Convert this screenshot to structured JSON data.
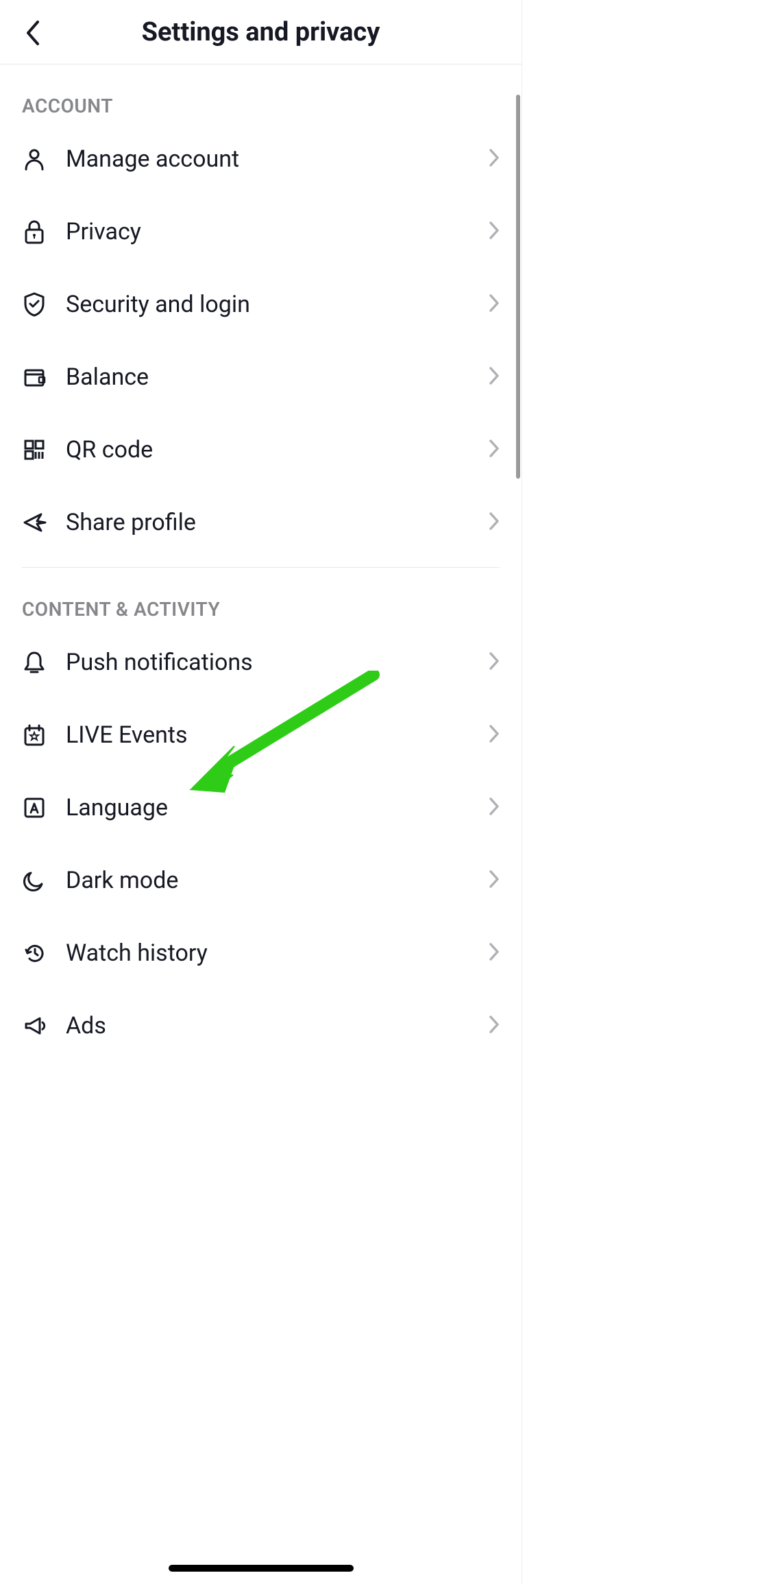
{
  "header": {
    "title": "Settings and privacy"
  },
  "sections": [
    {
      "title": "ACCOUNT",
      "items": [
        {
          "label": "Manage account",
          "icon": "user"
        },
        {
          "label": "Privacy",
          "icon": "lock"
        },
        {
          "label": "Security and login",
          "icon": "shield"
        },
        {
          "label": "Balance",
          "icon": "wallet"
        },
        {
          "label": "QR code",
          "icon": "qr"
        },
        {
          "label": "Share profile",
          "icon": "share"
        }
      ]
    },
    {
      "title": "CONTENT & ACTIVITY",
      "items": [
        {
          "label": "Push notifications",
          "icon": "bell"
        },
        {
          "label": "LIVE Events",
          "icon": "calendar"
        },
        {
          "label": "Language",
          "icon": "language"
        },
        {
          "label": "Dark mode",
          "icon": "moon"
        },
        {
          "label": "Watch history",
          "icon": "history"
        },
        {
          "label": "Ads",
          "icon": "megaphone"
        }
      ]
    }
  ],
  "annotation": {
    "target": "Language",
    "color": "#2ECC17"
  }
}
